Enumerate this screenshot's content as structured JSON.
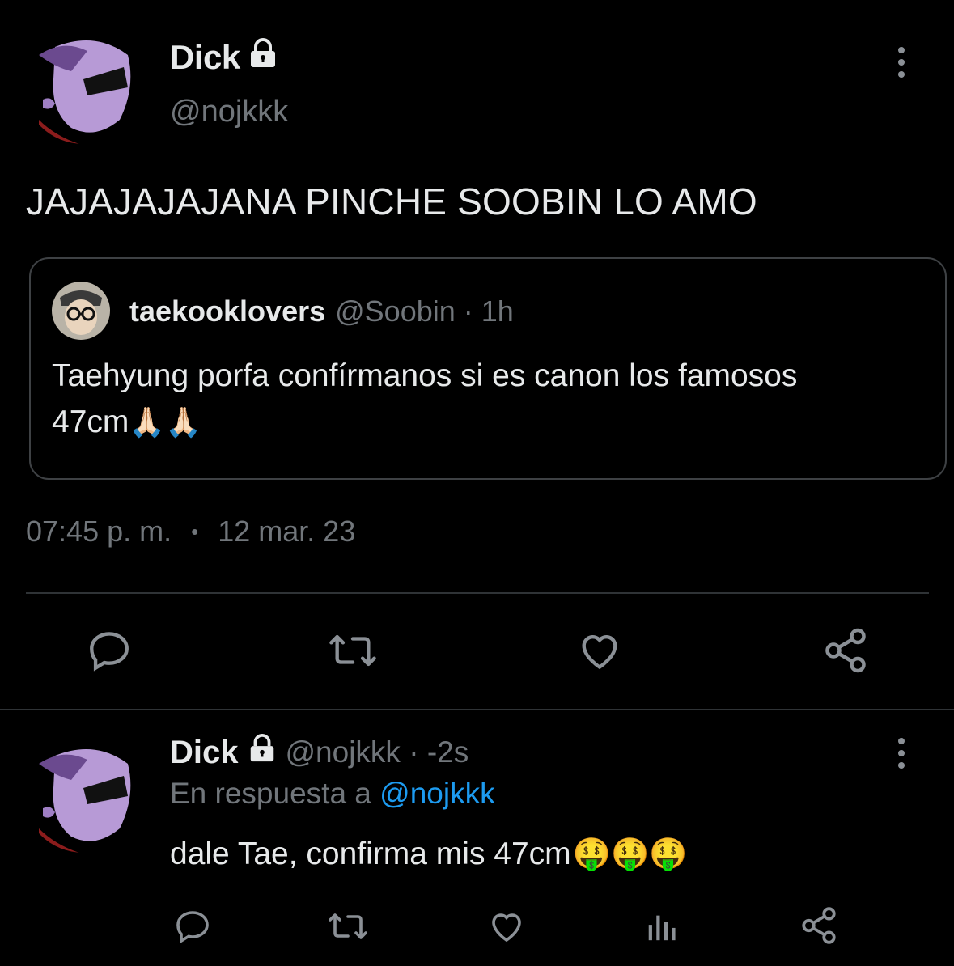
{
  "main_tweet": {
    "author_name": "Dick",
    "author_handle": "@nojkkk",
    "text": "JAJAJAJAJANA PINCHE SOOBIN LO AMO",
    "quote": {
      "name": "taekooklovers",
      "meta": "@Soobin · 1h",
      "text_line1": "Taehyung porfa confírmanos si es canon los famosos",
      "text_line2": "47cm",
      "emoji": "🙏🏻🙏🏻"
    },
    "time": "07:45 p. m.",
    "separator": "•",
    "date": "12 mar. 23"
  },
  "actions": {
    "reply_icon": "reply-icon",
    "retweet_icon": "retweet-icon",
    "like_icon": "heart-icon",
    "share_icon": "share-icon",
    "stats_icon": "stats-icon"
  },
  "reply": {
    "author_name": "Dick",
    "meta": "@nojkkk · -2s",
    "in_reply_prefix": "En respuesta a",
    "in_reply_handle": "@nojkkk",
    "text": "dale Tae, confirma mis 47cm",
    "emoji": "🤑🤑🤑"
  },
  "colors": {
    "background": "#000000",
    "text": "#e7e9ea",
    "muted": "#71767b",
    "link": "#1d9bf0",
    "border": "#2f3336"
  }
}
